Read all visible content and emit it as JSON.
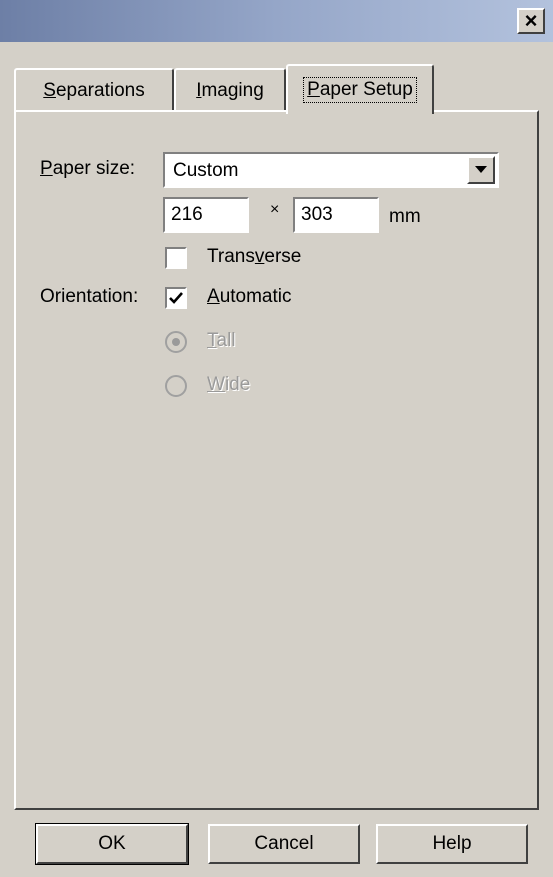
{
  "window": {
    "close_glyph": "×"
  },
  "tabs": [
    {
      "label_u": "S",
      "label_rest": "eparations",
      "active": false
    },
    {
      "label_u": "I",
      "label_rest": "maging",
      "active": false
    },
    {
      "label_u": "P",
      "label_rest": "aper Setup",
      "active": true
    }
  ],
  "paper_size": {
    "label_u": "P",
    "label_rest": "aper size:",
    "value": "Custom",
    "width": "216",
    "height": "303",
    "separator": "×",
    "unit": "mm"
  },
  "transverse": {
    "label_pre": "Trans",
    "label_u": "v",
    "label_rest": "erse",
    "checked": false
  },
  "orientation": {
    "label": "Orientation:",
    "automatic": {
      "label_u": "A",
      "label_rest": "utomatic",
      "checked": true
    },
    "tall": {
      "label_u": "T",
      "label_rest": "all",
      "selected": true,
      "enabled": false
    },
    "wide": {
      "label_u": "W",
      "label_rest": "ide",
      "selected": false,
      "enabled": false
    }
  },
  "buttons": {
    "ok": "OK",
    "cancel": "Cancel",
    "help": "Help"
  },
  "colors": {
    "face": "#d4d0c8",
    "title_gradient_start": "#6d7fa6",
    "disabled_text": "#9a9a9a"
  }
}
